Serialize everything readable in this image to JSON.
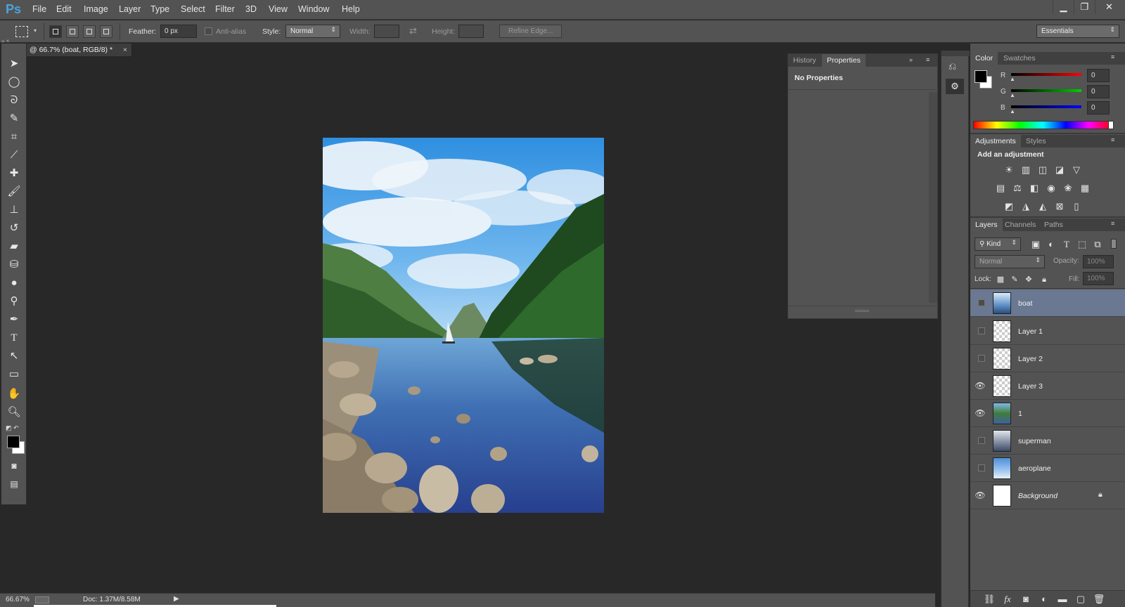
{
  "app": {
    "logo": "Ps"
  },
  "menu": [
    "File",
    "Edit",
    "Image",
    "Layer",
    "Type",
    "Select",
    "Filter",
    "3D",
    "View",
    "Window",
    "Help"
  ],
  "window_controls": {
    "minimize": "▁",
    "restore": "❐",
    "close": "✕"
  },
  "options": {
    "feather_label": "Feather:",
    "feather_value": "0 px",
    "antialias_label": "Anti-alias",
    "style_label": "Style:",
    "style_value": "Normal",
    "width_label": "Width:",
    "height_label": "Height:",
    "refine_edge": "Refine Edge...",
    "workspace": "Essentials"
  },
  "document": {
    "tab_title": "@ 66.7% (boat, RGB/8) *",
    "close": "×"
  },
  "status": {
    "zoom": "66.67%",
    "doc": "Doc: 1.37M/8.58M"
  },
  "properties_panel": {
    "tabs": [
      "History",
      "Properties"
    ],
    "message": "No Properties"
  },
  "color_panel": {
    "tabs": [
      "Color",
      "Swatches"
    ],
    "channels": [
      {
        "label": "R",
        "value": "0",
        "color": "#ff0000"
      },
      {
        "label": "G",
        "value": "0",
        "color": "#00cc00"
      },
      {
        "label": "B",
        "value": "0",
        "color": "#0000ff"
      }
    ]
  },
  "adjustments_panel": {
    "tabs": [
      "Adjustments",
      "Styles"
    ],
    "title": "Add an adjustment"
  },
  "layers_panel": {
    "tabs": [
      "Layers",
      "Channels",
      "Paths"
    ],
    "kind": "Kind",
    "blend_mode": "Normal",
    "opacity_label": "Opacity:",
    "opacity_value": "100%",
    "lock_label": "Lock:",
    "fill_label": "Fill:",
    "fill_value": "100%",
    "layers": [
      {
        "name": "boat",
        "visible": false,
        "selected": true,
        "thumb": "photo"
      },
      {
        "name": "Layer 1",
        "visible": false,
        "selected": false,
        "thumb": "transparent"
      },
      {
        "name": "Layer 2",
        "visible": false,
        "selected": false,
        "thumb": "transparent"
      },
      {
        "name": "Layer 3",
        "visible": true,
        "selected": false,
        "thumb": "transparent"
      },
      {
        "name": "1",
        "visible": true,
        "selected": false,
        "thumb": "photo"
      },
      {
        "name": "superman",
        "visible": false,
        "selected": false,
        "thumb": "photo"
      },
      {
        "name": "aeroplane",
        "visible": false,
        "selected": false,
        "thumb": "photo"
      },
      {
        "name": "Background",
        "visible": true,
        "selected": false,
        "thumb": "white",
        "locked": true
      }
    ]
  },
  "colors": {
    "accent_selected_layer": "#6a7891",
    "foreground": "#000000",
    "background": "#ffffff"
  }
}
